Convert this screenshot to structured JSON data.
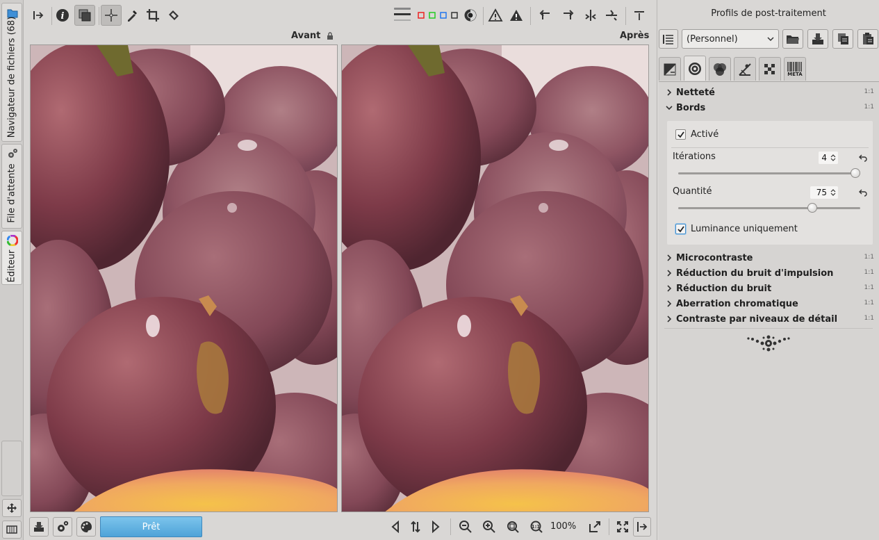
{
  "left_tabs": {
    "file_browser": "Navigateur de fichiers  (68)",
    "queue": "File d'attente",
    "editor": "Éditeur"
  },
  "panes": {
    "before_label": "Avant",
    "after_label": "Après"
  },
  "bottombar": {
    "progress_label": "Prêt",
    "zoom_value": "100%"
  },
  "right_panel": {
    "title": "Profils de post-traitement",
    "profile_selected": "(Personnel)",
    "sections": [
      {
        "title": "Netteté",
        "expanded": false,
        "badge": "1:1"
      },
      {
        "title": "Bords",
        "expanded": true,
        "badge": "1:1"
      },
      {
        "title": "Microcontraste",
        "expanded": false,
        "badge": "1:1"
      },
      {
        "title": "Réduction du bruit d'impulsion",
        "expanded": false,
        "badge": "1:1"
      },
      {
        "title": "Réduction du bruit",
        "expanded": false,
        "badge": "1:1"
      },
      {
        "title": "Aberration chromatique",
        "expanded": false,
        "badge": "1:1"
      },
      {
        "title": "Contraste par niveaux de détail",
        "expanded": false,
        "badge": "1:1"
      }
    ],
    "bords": {
      "enabled_label": "Activé",
      "enabled": true,
      "iterations_label": "Itérations",
      "iterations_value": "4",
      "iterations_fraction": 1.0,
      "quantity_label": "Quantité",
      "quantity_value": "75",
      "quantity_fraction": 0.75,
      "luminance_label": "Luminance uniquement",
      "luminance_only": true
    },
    "tab_meta_label": "META"
  },
  "colors": {
    "accent_progress": "#4ea3d8",
    "panel_bg": "#d9d7d5"
  }
}
